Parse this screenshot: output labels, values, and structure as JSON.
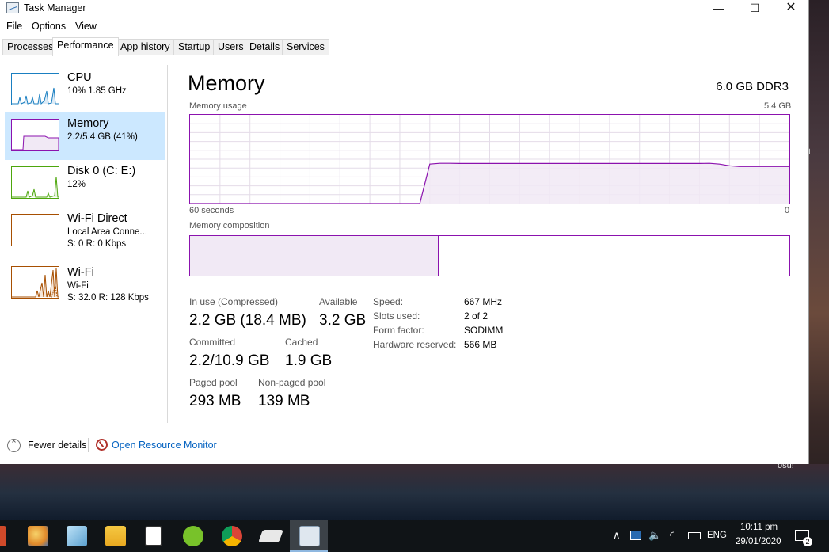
{
  "window": {
    "title": "Task Manager",
    "controls": {
      "minimize": "—",
      "maximize": "☐",
      "close": "✕"
    }
  },
  "menu": [
    "File",
    "Options",
    "View"
  ],
  "tabs": [
    "Processes",
    "Performance",
    "App history",
    "Startup",
    "Users",
    "Details",
    "Services"
  ],
  "active_tab": "Performance",
  "sidebar": {
    "items": [
      {
        "name": "CPU",
        "line1": "10% 1.85 GHz",
        "line2": "",
        "color": "#1a7fc1",
        "selected": false
      },
      {
        "name": "Memory",
        "line1": "2.2/5.4 GB (41%)",
        "line2": "",
        "color": "#8b12ae",
        "selected": true
      },
      {
        "name": "Disk 0 (C: E:)",
        "line1": "12%",
        "line2": "",
        "color": "#4da60c",
        "selected": false
      },
      {
        "name": "Wi-Fi Direct",
        "line1": "Local Area Conne...",
        "line2": "S: 0 R: 0 Kbps",
        "color": "#a74f01",
        "selected": false
      },
      {
        "name": "Wi-Fi",
        "line1": "Wi-Fi",
        "line2": "S: 32.0 R: 128 Kbps",
        "color": "#a74f01",
        "selected": false
      }
    ]
  },
  "main": {
    "title": "Memory",
    "spec": "6.0 GB DDR3",
    "usage_label": "Memory usage",
    "usage_max": "5.4 GB",
    "time_left": "60 seconds",
    "time_right": "0",
    "composition_label": "Memory composition",
    "accent_color": "#8b12ae",
    "fill_color": "#f1e9f5",
    "usage_series_gb": [
      0,
      0,
      0,
      0,
      0,
      0,
      0,
      0,
      0,
      0,
      0,
      0,
      0,
      0,
      0,
      0,
      0,
      0,
      0,
      0,
      0,
      0,
      0,
      0,
      2.4,
      2.45,
      2.45,
      2.44,
      2.44,
      2.44,
      2.44,
      2.44,
      2.44,
      2.44,
      2.44,
      2.44,
      2.44,
      2.44,
      2.44,
      2.44,
      2.44,
      2.44,
      2.44,
      2.44,
      2.44,
      2.44,
      2.44,
      2.44,
      2.44,
      2.44,
      2.44,
      2.44,
      2.45,
      2.4,
      2.3,
      2.25,
      2.25,
      2.25,
      2.25,
      2.25,
      2.25
    ],
    "composition": {
      "in_use_fraction": 0.41,
      "modified_fraction": 0.005,
      "standby_fraction": 0.35,
      "free_fraction": 0.235
    }
  },
  "stats": {
    "in_use_label": "In use (Compressed)",
    "in_use_value": "2.2 GB (18.4 MB)",
    "available_label": "Available",
    "available_value": "3.2 GB",
    "committed_label": "Committed",
    "committed_value": "2.2/10.9 GB",
    "cached_label": "Cached",
    "cached_value": "1.9 GB",
    "paged_label": "Paged pool",
    "paged_value": "293 MB",
    "nonpaged_label": "Non-paged pool",
    "nonpaged_value": "139 MB"
  },
  "details": [
    {
      "label": "Speed:",
      "value": "667 MHz"
    },
    {
      "label": "Slots used:",
      "value": "2 of 2"
    },
    {
      "label": "Form factor:",
      "value": "SODIMM"
    },
    {
      "label": "Hardware reserved:",
      "value": "566 MB"
    }
  ],
  "footer": {
    "fewer": "Fewer details",
    "monitor": "Open Resource Monitor"
  },
  "desktop": {
    "osu_label": "osu!",
    "edge_text": "t"
  },
  "taskbar": {
    "apps": [
      "paint-icon",
      "notepad-icon",
      "file-explorer-icon",
      "calculator-icon",
      "utorrent-icon",
      "chrome-icon",
      "drive-icon",
      "task-manager-icon"
    ],
    "language": "ENG",
    "time": "10:11 pm",
    "date": "29/01/2020",
    "notifications": "2"
  }
}
